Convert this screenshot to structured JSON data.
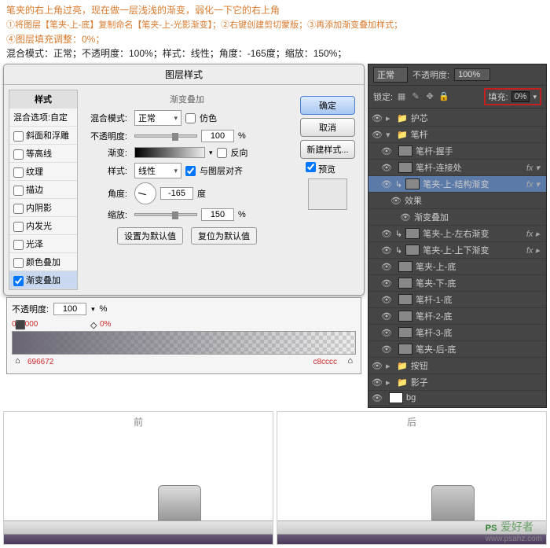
{
  "instructions": {
    "line1": "笔夹的右上角过亮，现在做一层浅浅的渐变，弱化一下它的右上角",
    "line2a": "①将图层【笔夹-上-底】复制命名",
    "line2b": "【笔夹-上-光影渐变】",
    "line2c": "；②右键创建剪切蒙版；③再添加渐变叠加样式；",
    "line3": "④图层填充调整：0%；",
    "line4": "混合模式：正常；不透明度：100%；样式：线性；角度：-165度；缩放：150%；"
  },
  "dialog": {
    "title": "图层样式",
    "left": {
      "styles": "样式",
      "blendopt": "混合选项:自定",
      "bevel": "斜面和浮雕",
      "contour": "等高线",
      "texture": "纹理",
      "stroke": "描边",
      "innershadow": "内阴影",
      "innerglow": "内发光",
      "glow": "光泽",
      "coloroverlay": "颜色叠加",
      "gradoverlay": "渐变叠加"
    },
    "group": "渐变叠加",
    "sub": "渐变",
    "blendmode_lbl": "混合模式:",
    "blendmode_val": "正常",
    "dither": "仿色",
    "opacity_lbl": "不透明度:",
    "opacity_val": "100",
    "pct": "%",
    "gradient_lbl": "渐变:",
    "reverse": "反向",
    "style_lbl": "样式:",
    "style_val": "线性",
    "align": "与图层对齐",
    "angle_lbl": "角度:",
    "angle_val": "-165",
    "deg": "度",
    "scale_lbl": "缩放:",
    "scale_val": "150",
    "setdefault": "设置为默认值",
    "resetdefault": "复位为默认值",
    "ok": "确定",
    "cancel": "取消",
    "newstyle": "新建样式...",
    "preview": "预览"
  },
  "gradedit": {
    "opacity_lbl": "不透明度:",
    "opacity_val": "100",
    "pct": "%",
    "stop_black": "000000",
    "stop_0": "0%",
    "stop_left": "696672",
    "stop_right": "c8cccc"
  },
  "panel": {
    "mode": "正常",
    "opacity_lbl": "不透明度:",
    "opacity_val": "100%",
    "lock_lbl": "锁定:",
    "fill_lbl": "填充:",
    "fill_val": "0%",
    "layers": {
      "l1": "护芯",
      "l2": "笔杆",
      "l3": "笔杆-握手",
      "l4": "笔杆-连接处",
      "l5": "笔夹-上-结构渐变",
      "l6": "效果",
      "l7": "渐变叠加",
      "l8": "笔夹-上-左右渐变",
      "l9": "笔夹-上-上下渐变",
      "l10": "笔夹-上-底",
      "l11": "笔夹-下-底",
      "l12": "笔杆-1-底",
      "l13": "笔杆-2-底",
      "l14": "笔杆-3-底",
      "l15": "笔夹-后-底",
      "l16": "按钮",
      "l17": "影子",
      "l18": "bg"
    }
  },
  "preview": {
    "before": "前",
    "after": "后"
  },
  "watermark": {
    "brand": "PS",
    "cn": "爱好者",
    "url": "www.psahz.com"
  }
}
